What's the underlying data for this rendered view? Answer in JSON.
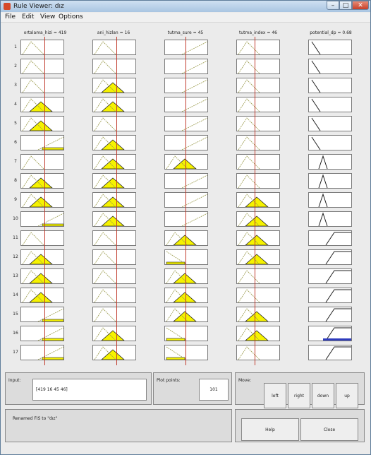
{
  "window": {
    "title": "Rule Viewer: dız"
  },
  "menu": [
    {
      "label": "File"
    },
    {
      "label": "Edit"
    },
    {
      "label": "View"
    },
    {
      "label": "Options"
    }
  ],
  "variables": [
    {
      "label": "ortalama_hizi = 419"
    },
    {
      "label": "ani_hizlan = 16"
    },
    {
      "label": "tutma_sure = 45"
    },
    {
      "label": "tutma_index = 46"
    },
    {
      "label": "potential_dp = 0.68"
    }
  ],
  "rule_numbers": [
    "1",
    "2",
    "3",
    "4",
    "5",
    "6",
    "7",
    "8",
    "9",
    "10",
    "11",
    "12",
    "13",
    "14",
    "15",
    "16",
    "17"
  ],
  "controls": {
    "input_label": "Input:",
    "input_value": "[419 16 45 46]",
    "plot_points_label": "Plot points:",
    "plot_points_value": "101",
    "move_label": "Move:",
    "left": "left",
    "right": "right",
    "down": "down",
    "up": "up",
    "help": "Help",
    "close": "Close",
    "status": "Renamed FIS to \"dız\""
  },
  "colors": {
    "fill": "#f5f200",
    "stroke": "#9a9a4a",
    "line": "#c0392b",
    "output_fill": "#2e3bbd"
  }
}
